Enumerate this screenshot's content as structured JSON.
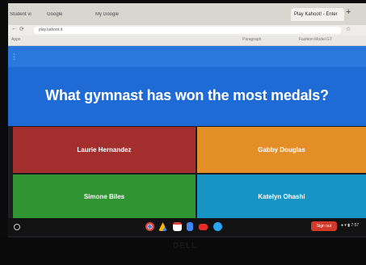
{
  "browser": {
    "tabs": [
      "Student vi",
      "Google",
      "My Google",
      "",
      "Play Kahoot! - Enter",
      ""
    ],
    "new_tab": "+",
    "url": "play.kahoot.it",
    "bookmarks": [
      "Apps",
      "Paragraph",
      "Fashion Model GT"
    ]
  },
  "quiz": {
    "question": "What gymnast has won the most medals?",
    "answers": [
      {
        "label": "Laurie Hernandez",
        "color": "#a22f2d"
      },
      {
        "label": "Gabby Douglas",
        "color": "#e38e26"
      },
      {
        "label": "Simone Biles",
        "color": "#2f9431"
      },
      {
        "label": "Katelyn Ohashi",
        "color": "#1695c5"
      }
    ]
  },
  "shelf": {
    "apps": [
      "chrome-icon",
      "drive-icon",
      "gmail-icon",
      "docs-icon",
      "youtube-icon",
      "duo-icon"
    ],
    "sign_out": "Sign out",
    "tray": "● ▾ ▮ 7:57"
  },
  "device": {
    "brand": "DELL"
  }
}
